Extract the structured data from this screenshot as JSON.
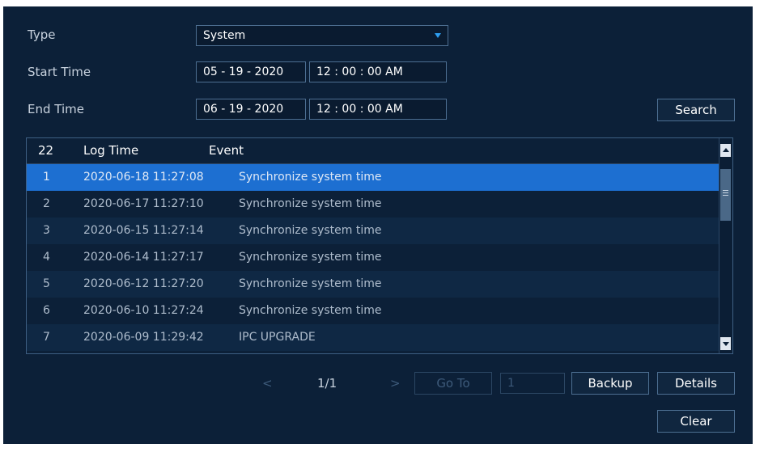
{
  "filters": {
    "type_label": "Type",
    "type_value": "System",
    "start_label": "Start Time",
    "start_date": "05 - 19 - 2020",
    "start_time": "12 : 00 : 00 AM",
    "end_label": "End Time",
    "end_date": "06 - 19 - 2020",
    "end_time": "12 : 00 : 00 AM",
    "search_label": "Search"
  },
  "table": {
    "count": "22",
    "col_time": "Log Time",
    "col_event": "Event",
    "rows": [
      {
        "n": "1",
        "time": "2020-06-18 11:27:08",
        "event": "Synchronize system time"
      },
      {
        "n": "2",
        "time": "2020-06-17 11:27:10",
        "event": "Synchronize system time"
      },
      {
        "n": "3",
        "time": "2020-06-15 11:27:14",
        "event": "Synchronize system time"
      },
      {
        "n": "4",
        "time": "2020-06-14 11:27:17",
        "event": "Synchronize system time"
      },
      {
        "n": "5",
        "time": "2020-06-12 11:27:20",
        "event": "Synchronize system time"
      },
      {
        "n": "6",
        "time": "2020-06-10 11:27:24",
        "event": "Synchronize system time"
      },
      {
        "n": "7",
        "time": "2020-06-09 11:29:42",
        "event": "IPC UPGRADE"
      }
    ]
  },
  "pager": {
    "prev": "<",
    "page": "1/1",
    "next": ">",
    "goto_label": "Go To",
    "goto_value": "1"
  },
  "actions": {
    "backup_label": "Backup",
    "details_label": "Details",
    "clear_label": "Clear"
  },
  "colors": {
    "panel_bg": "#0c2038",
    "selected_row": "#1d6fd1",
    "dropdown_arrow": "#2e9ef0"
  }
}
